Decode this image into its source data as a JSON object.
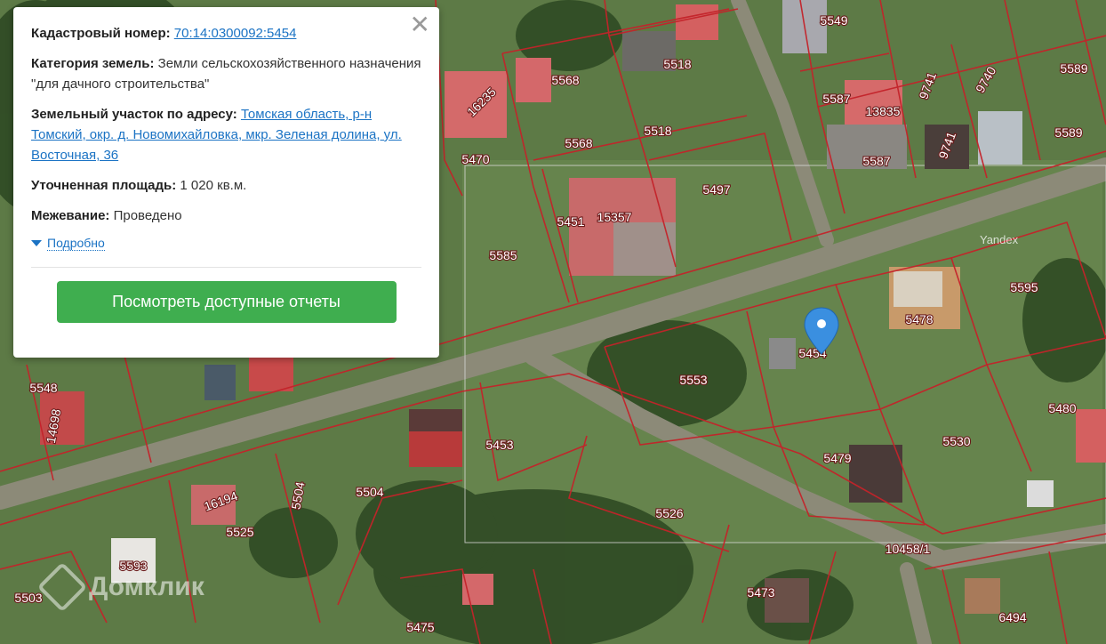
{
  "popup": {
    "cadastral_label": "Кадастровый номер:",
    "cadastral_value": "70:14:0300092:5454",
    "category_label": "Категория земель:",
    "category_value": "Земли сельскохозяйственного назначения",
    "category_purpose": "\"для дачного строительства\"",
    "address_label": "Земельный участок по адресу:",
    "address_value": "Томская область, р-н Томский, окр. д. Новомихайловка, мкр. Зеленая долина, ул. Восточная, 36",
    "area_label": "Уточненная площадь:",
    "area_value": "1 020 кв.м.",
    "survey_label": "Межевание:",
    "survey_value": "Проведено",
    "details_label": "Подробно",
    "reports_button": "Посмотреть доступные отчеты",
    "close_icon": "close-icon"
  },
  "map": {
    "provider": "Yandex",
    "watermark": "Домклик",
    "marker_icon": "location-pin-icon",
    "marker_color": "#3a8fe0",
    "parcel_border_color": "#c4232a",
    "parcel_labels": [
      "5549",
      "5589",
      "5518",
      "5568",
      "16235",
      "5587",
      "13835",
      "9741",
      "9740",
      "5568",
      "5518",
      "5589",
      "5470",
      "9741",
      "5587",
      "5497",
      "5451",
      "15357",
      "5585",
      "5595",
      "5478",
      "5454",
      "5553",
      "5548",
      "14698",
      "5480",
      "5453",
      "5530",
      "5479",
      "5504",
      "16194",
      "5504",
      "5526",
      "5525",
      "5593",
      "10458/1",
      "5503",
      "5473",
      "5475",
      "6494"
    ]
  }
}
